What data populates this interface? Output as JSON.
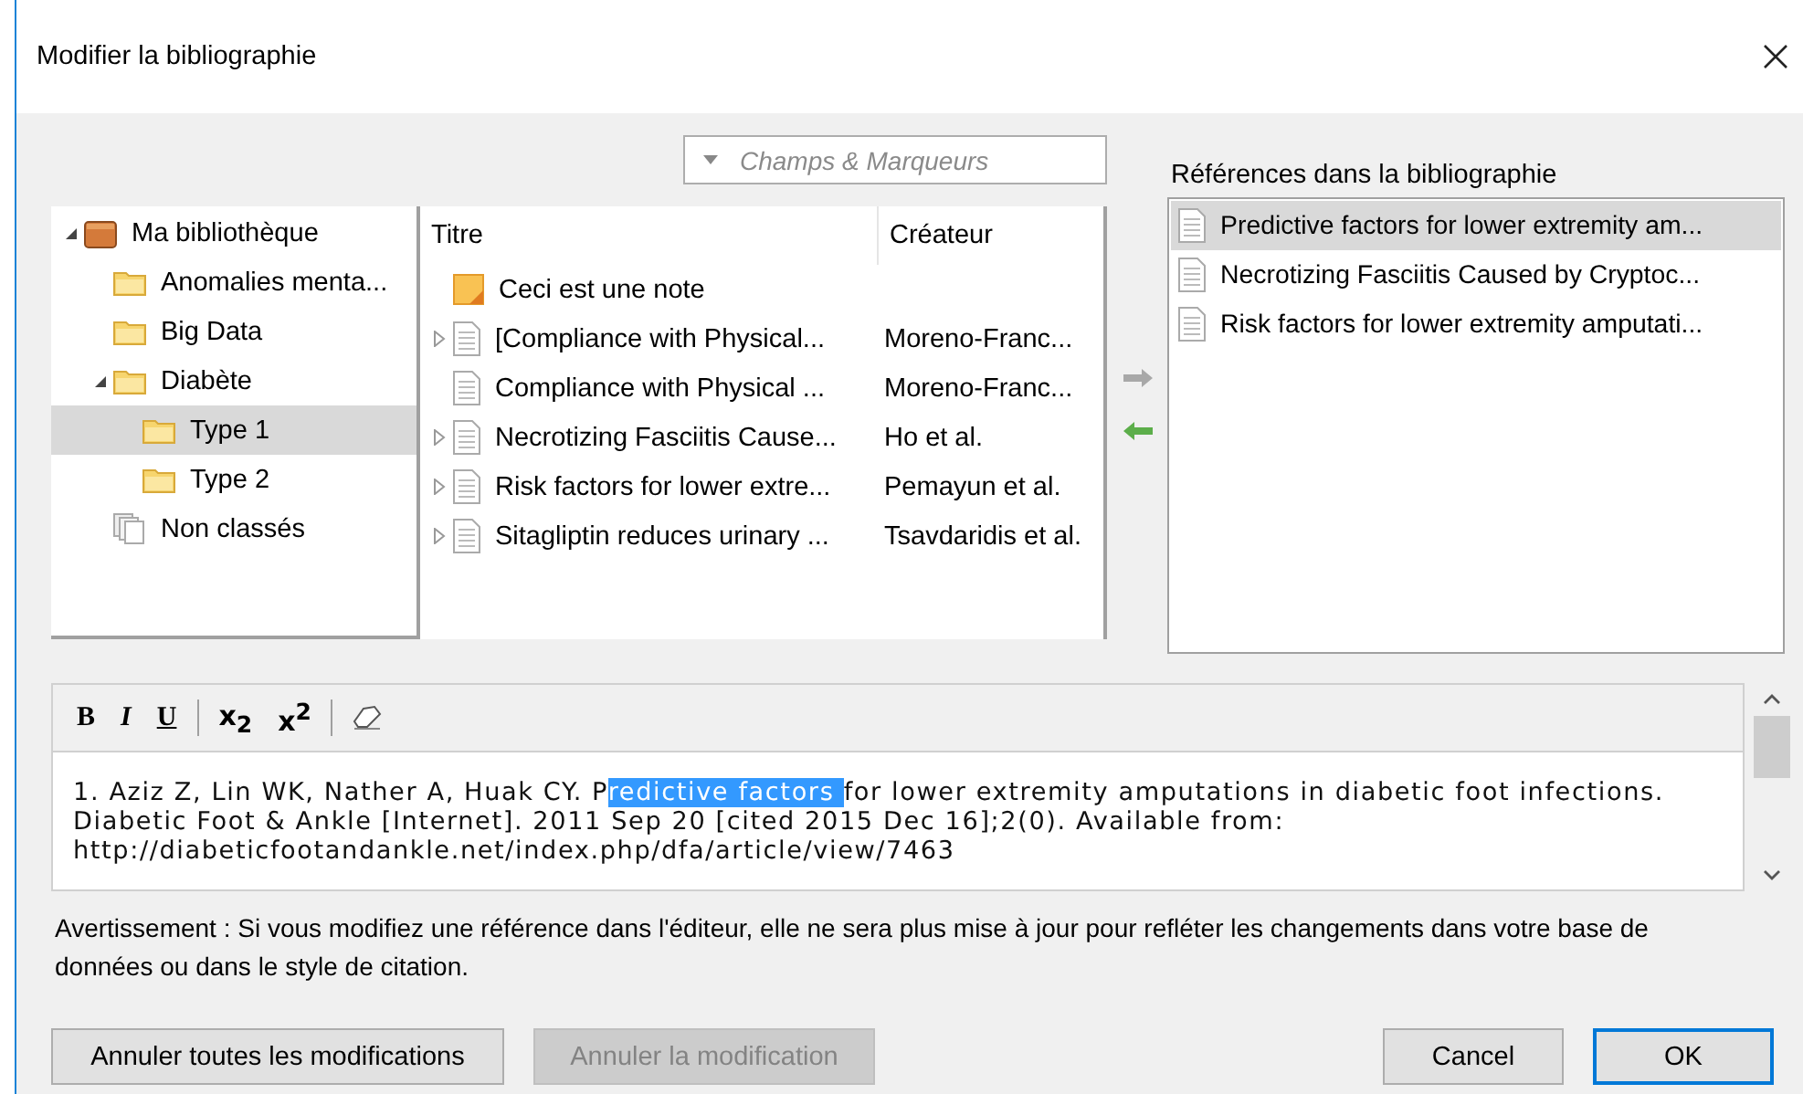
{
  "window": {
    "title": "Modifier la bibliographie"
  },
  "filter": {
    "placeholder": "Champs & Marqueurs"
  },
  "tree": [
    {
      "label": "Ma bibliothèque",
      "kind": "library",
      "expanded": true,
      "selected": false,
      "children": [
        {
          "label": "Anomalies menta...",
          "kind": "folder",
          "selected": false
        },
        {
          "label": "Big Data",
          "kind": "folder",
          "selected": false
        },
        {
          "label": "Diabète",
          "kind": "folder",
          "expanded": true,
          "selected": false,
          "children": [
            {
              "label": "Type 1",
              "kind": "folder",
              "selected": true
            },
            {
              "label": "Type 2",
              "kind": "folder",
              "selected": false
            }
          ]
        },
        {
          "label": "Non classés",
          "kind": "unfiled",
          "selected": false
        }
      ]
    }
  ],
  "items": {
    "columns": [
      "Titre",
      "Créateur"
    ],
    "rows": [
      {
        "kind": "note",
        "expandable": false,
        "title": "Ceci est une note"
      },
      {
        "kind": "document",
        "expandable": true,
        "title": "[Compliance with Physical...",
        "creator": "Moreno-Franc..."
      },
      {
        "kind": "document",
        "expandable": false,
        "title": "Compliance with Physical ...",
        "creator": "Moreno-Franc..."
      },
      {
        "kind": "document",
        "expandable": true,
        "title": "Necrotizing Fasciitis Cause...",
        "creator": "Ho et al."
      },
      {
        "kind": "document",
        "expandable": true,
        "title": "Risk factors for lower extre...",
        "creator": "Pemayun et al."
      },
      {
        "kind": "document",
        "expandable": true,
        "title": "Sitagliptin reduces urinary ...",
        "creator": "Tsavdaridis et al."
      }
    ]
  },
  "references": {
    "label": "Références dans la bibliographie",
    "items": [
      {
        "title": "Predictive factors for lower extremity am...",
        "selected": true
      },
      {
        "title": "Necrotizing Fasciitis Caused by Cryptoc...",
        "selected": false
      },
      {
        "title": "Risk factors for lower extremity amputati...",
        "selected": false
      }
    ]
  },
  "editor": {
    "toolbar": [
      {
        "kind": "bold",
        "label": "B"
      },
      {
        "kind": "italic",
        "label": "I"
      },
      {
        "kind": "underline",
        "label": "U"
      },
      {
        "kind": "subscript",
        "label": "x$_{2}$"
      },
      {
        "kind": "superscript",
        "label": "x$^{2}$"
      },
      {
        "kind": "clear"
      }
    ],
    "citation": {
      "before": "1.  Aziz Z, Lin WK, Nather A, Huak CY. P",
      "selection": "redictive factors ",
      "after": "for lower extremity amputations in diabetic foot infections. Diabetic Foot & Ankle [Internet]. 2011 Sep 20 [cited 2015 Dec 16];2(0). Available from: http://diabeticfootandankle.net/index.php/dfa/article/view/7463"
    }
  },
  "warning": "Avertissement : Si vous modifiez une référence dans l'éditeur, elle ne sera plus mise à jour pour refléter les changements dans votre base de données ou dans le style de citation.",
  "buttons": [
    {
      "label": "Annuler toutes les modifications",
      "disabled": false,
      "default": false
    },
    {
      "label": "Annuler la modification",
      "disabled": true,
      "default": false
    },
    {
      "label": "Cancel",
      "disabled": false,
      "default": false
    },
    {
      "label": "OK",
      "disabled": false,
      "default": true
    }
  ]
}
